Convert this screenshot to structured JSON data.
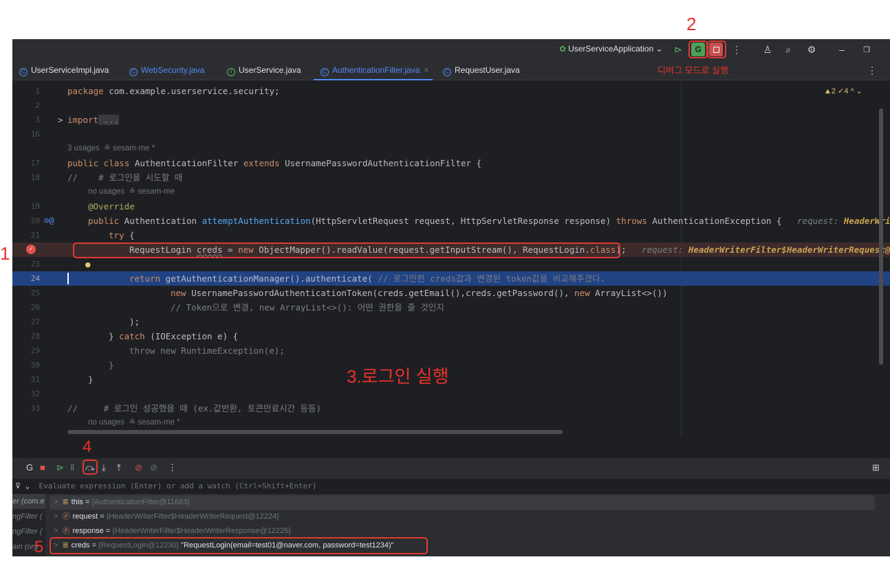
{
  "annotations": {
    "n1": "1",
    "n2": "2",
    "n3": "3.로그인 실행",
    "n4": "4",
    "n5": "5",
    "debug_mode_note": "디버그 모드로 실행"
  },
  "titlebar": {
    "run_config": "UserServiceApplication ⌄",
    "icons": [
      "resume-icon",
      "debug-icon",
      "stop-icon",
      "more-icon",
      "add-user-icon",
      "search-icon",
      "settings-icon",
      "minimize-icon",
      "maximize-icon"
    ]
  },
  "tabs": [
    {
      "label": "UserServiceImpl.java"
    },
    {
      "label": "WebSecurity.java"
    },
    {
      "label": "UserService.java"
    },
    {
      "label": "AuthenticationFilter.java"
    },
    {
      "label": "RequestUser.java"
    }
  ],
  "tab_close": "×",
  "editor": {
    "problems_badge": "▲2 ✓4 ^ ⌄",
    "hints": {
      "h1": "3 usages  ≗ sesam-me *",
      "h2": "no usages  ≗ sesam-me",
      "h3": "no usages  ≗ sesam-me *"
    },
    "line_numbers": [
      "1",
      "2",
      "3",
      "16",
      "17",
      "18",
      "19",
      "20",
      "21",
      "22",
      "23",
      "24",
      "25",
      "26",
      "27",
      "28",
      "29",
      "30",
      "31",
      "32",
      "33"
    ],
    "code": {
      "l1_kw": "package",
      "l1_rest": " com.example.userservice.security;",
      "l3_kw": "import",
      "l3_rest": " ...",
      "l17_a": "public class",
      "l17_b": " AuthenticationFilter ",
      "l17_c": "extends",
      "l17_d": " UsernamePasswordAuthenticationFilter {",
      "l18": "//    # 로그인을 시도할 때",
      "l19": "@Override",
      "l20_a": "public",
      "l20_b": " Authentication ",
      "l20_c": "attemptAuthentication",
      "l20_d": "(HttpServletRequest request, HttpServletResponse response) ",
      "l20_e": "throws",
      "l20_f": " AuthenticationException {",
      "l20_hint_a": "request: ",
      "l20_hint_b": "HeaderWrit",
      "l21_a": "try",
      "l21_b": " {",
      "l22_a": "RequestLogin ",
      "l22_b": "creds",
      "l22_c": " = ",
      "l22_d": "new",
      "l22_e": " ObjectMapper().readValue(request.getInputStream(), RequestLogin.",
      "l22_f": "class",
      "l22_g": ");",
      "l22_hint_a": "request: ",
      "l22_hint_b": "HeaderWriterFilter$HeaderWriterRequest@1",
      "l24_a": "return",
      "l24_b": " getAuthenticationManager().authenticate( ",
      "l24_c": "// 로그인한 creds값과 변경된 token값을 비교해주겠다.",
      "l25_a": "new",
      "l25_b": " UsernamePasswordAuthenticationToken(creds.getEmail(),creds.getPassword(), ",
      "l25_c": "new",
      "l25_d": " ArrayList<>())",
      "l26": "// Token으로 변경, new ArrayList<>(): 어떤 권한을 줄 것인지",
      "l27": ");",
      "l28_a": "} ",
      "l28_b": "catch",
      "l28_c": " (IOException e) {",
      "l29": "throw new RuntimeException(e);",
      "l30": "}",
      "l31": "}",
      "l33": "//     # 로그인 성공했을 때 (ex.값반환, 토큰만료시간 등등)"
    }
  },
  "debugger": {
    "eval_placeholder": "Evaluate expression (Enter) or add a watch (Ctrl+Shift+Enter)",
    "frames": [
      "er (com.e",
      "ngFilter (",
      "ngFilter (",
      "ain (org"
    ],
    "variables": [
      {
        "name": "this",
        "eq": " = ",
        "ref": "{AuthenticationFilter@11683}",
        "value": ""
      },
      {
        "name": "request",
        "eq": " = ",
        "ref": "{HeaderWriterFilter$HeaderWriterRequest@12224}",
        "value": ""
      },
      {
        "name": "response",
        "eq": " = ",
        "ref": "{HeaderWriterFilter$HeaderWriterResponse@12225}",
        "value": ""
      },
      {
        "name": "creds",
        "eq": " = ",
        "ref": "{RequestLogin@12230}",
        "value": " \"RequestLogin(email=test01@naver.com, password=test1234)\""
      }
    ]
  }
}
